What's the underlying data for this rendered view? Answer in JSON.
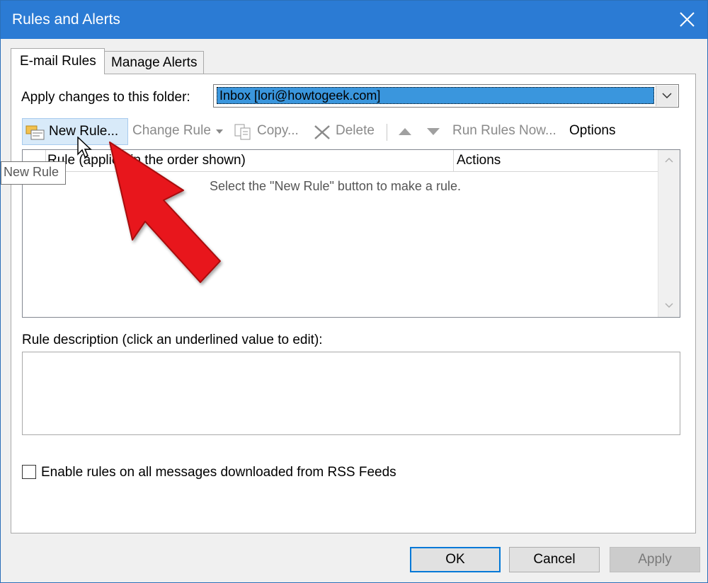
{
  "window": {
    "title": "Rules and Alerts",
    "accent_color": "#2b7bd4"
  },
  "tabs": [
    {
      "label": "E-mail Rules",
      "selected": true
    },
    {
      "label": "Manage Alerts",
      "selected": false
    }
  ],
  "folder": {
    "label": "Apply changes to this folder:",
    "value": "Inbox [lori@howtogeek.com]"
  },
  "toolbar": {
    "new_rule": "New Rule...",
    "change_rule": "Change Rule",
    "copy": "Copy...",
    "delete": "Delete",
    "run_rules_now": "Run Rules Now...",
    "options": "Options"
  },
  "rules_list": {
    "col_rule": "Rule (applied in the order shown)",
    "col_actions": "Actions",
    "empty_message": "Select the \"New Rule\" button to make a rule."
  },
  "description": {
    "label": "Rule description (click an underlined value to edit):"
  },
  "rss": {
    "label": "Enable rules on all messages downloaded from RSS Feeds",
    "checked": false
  },
  "buttons": {
    "ok": "OK",
    "cancel": "Cancel",
    "apply": "Apply"
  },
  "tooltip": "New Rule",
  "annotation_arrow_color": "#e8171b"
}
